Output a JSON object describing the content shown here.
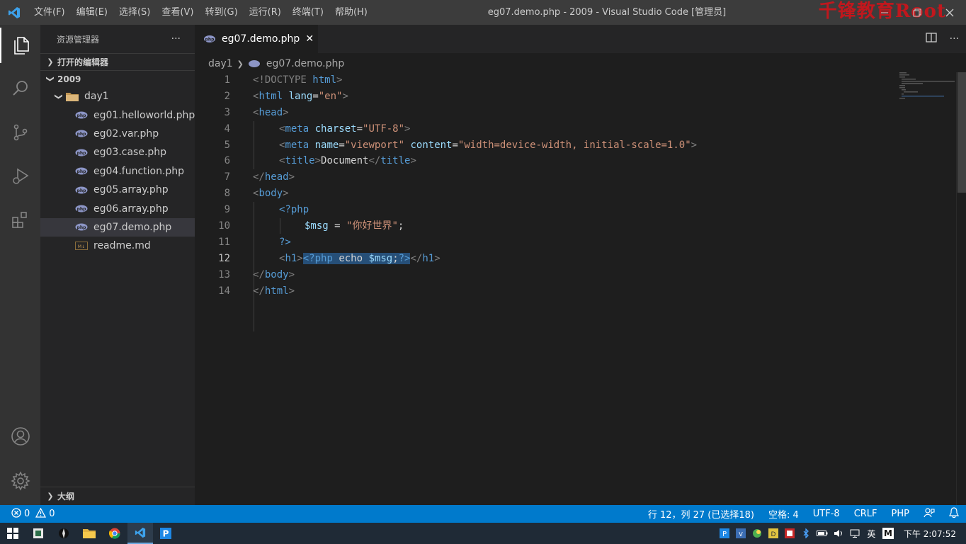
{
  "window": {
    "title": "eg07.demo.php - 2009 - Visual Studio Code [管理员]",
    "watermark": "千锋教育Root"
  },
  "menu": [
    "文件(F)",
    "编辑(E)",
    "选择(S)",
    "查看(V)",
    "转到(G)",
    "运行(R)",
    "终端(T)",
    "帮助(H)"
  ],
  "sidebar": {
    "title": "资源管理器",
    "more": "···",
    "open_editors": "打开的编辑器",
    "workspace": "2009",
    "folder": "day1",
    "files": [
      "eg01.helloworld.php",
      "eg02.var.php",
      "eg03.case.php",
      "eg04.function.php",
      "eg05.array.php",
      "eg06.array.php",
      "eg07.demo.php",
      "readme.md"
    ],
    "selected_file": "eg07.demo.php",
    "outline": "大纲"
  },
  "editor": {
    "tab_label": "eg07.demo.php",
    "breadcrumb": [
      "day1",
      "eg07.demo.php"
    ],
    "line_numbers": [
      "1",
      "2",
      "3",
      "4",
      "5",
      "6",
      "7",
      "8",
      "9",
      "10",
      "11",
      "12",
      "13",
      "14"
    ]
  },
  "code": {
    "l1": {
      "a": "<!DOCTYPE ",
      "b": "html",
      "c": ">"
    },
    "l2": {
      "a": "<",
      "b": "html",
      "c": " lang",
      "d": "=",
      "e": "\"en\"",
      "f": ">"
    },
    "l3": {
      "a": "<",
      "b": "head",
      "c": ">"
    },
    "l4": {
      "a": "<",
      "b": "meta",
      "c": " charset",
      "d": "=",
      "e": "\"UTF-8\"",
      "f": ">"
    },
    "l5": {
      "a": "<",
      "b": "meta",
      "c": " name",
      "d": "=",
      "e": "\"viewport\"",
      "f": " content",
      "g": "=",
      "h": "\"width=device-width, initial-scale=1.0\"",
      "i": ">"
    },
    "l6": {
      "a": "<",
      "b": "title",
      "c": ">",
      "d": "Document",
      "e": "</",
      "f": "title",
      "g": ">"
    },
    "l7": {
      "a": "</",
      "b": "head",
      "c": ">"
    },
    "l8": {
      "a": "<",
      "b": "body",
      "c": ">"
    },
    "l9": {
      "a": "<?php"
    },
    "l10": {
      "a": "$msg",
      "b": " = ",
      "c": "\"你好世界\"",
      "d": ";"
    },
    "l11": {
      "a": "?>"
    },
    "l12": {
      "a": "<",
      "b": "h1",
      "c": ">",
      "d": "<?php",
      "e": " echo ",
      "f": "$msg",
      "g": ";",
      "h": "?>",
      "i": "</",
      "j": "h1",
      "k": ">"
    },
    "l13": {
      "a": "</",
      "b": "body",
      "c": ">"
    },
    "l14": {
      "a": "</",
      "b": "html",
      "c": ">"
    }
  },
  "status": {
    "errors": "0",
    "warnings": "0",
    "position": "行 12，列 27 (已选择18)",
    "indent": "空格: 4",
    "encoding": "UTF-8",
    "eol": "CRLF",
    "language": "PHP"
  },
  "taskbar": {
    "ime": "英",
    "ime2": "M",
    "clock": "下午 2:07:52"
  },
  "colors": {
    "accent": "#007acc",
    "titlebar": "#3c3c3c",
    "sidebar": "#252526",
    "editor": "#1e1e1e"
  }
}
